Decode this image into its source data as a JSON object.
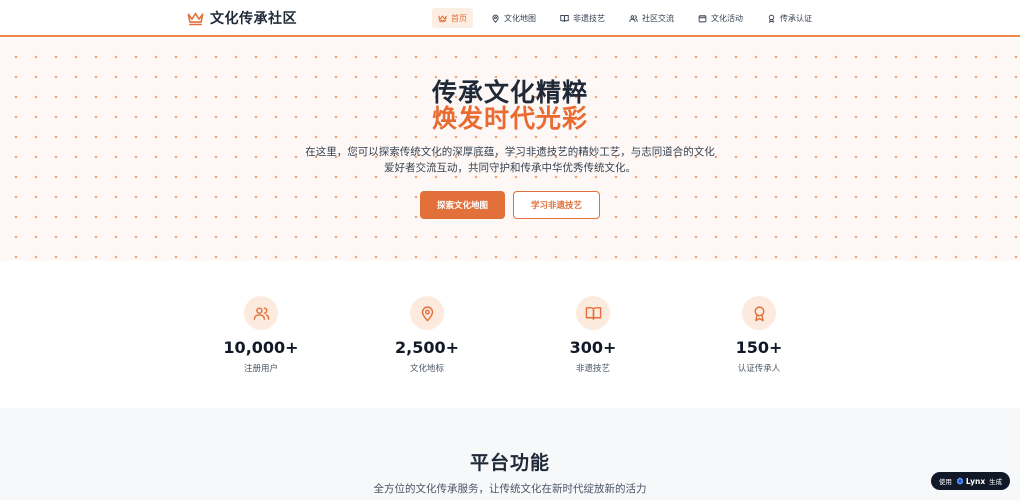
{
  "header": {
    "brand": "文化传承社区",
    "nav": [
      {
        "label": "首页",
        "icon": "crown-icon",
        "active": true
      },
      {
        "label": "文化地图",
        "icon": "map-pin-icon",
        "active": false
      },
      {
        "label": "非遗技艺",
        "icon": "book-icon",
        "active": false
      },
      {
        "label": "社区交流",
        "icon": "users-icon",
        "active": false
      },
      {
        "label": "文化活动",
        "icon": "calendar-icon",
        "active": false
      },
      {
        "label": "传承认证",
        "icon": "award-icon",
        "active": false
      }
    ]
  },
  "hero": {
    "title_line1": "传承文化精粹",
    "title_line2": "焕发时代光彩",
    "description": "在这里，您可以探索传统文化的深厚底蕴，学习非遗技艺的精妙工艺，与志同道合的文化爱好者交流互动，共同守护和传承中华优秀传统文化。",
    "primary_button": "探索文化地图",
    "secondary_button": "学习非遗技艺"
  },
  "stats": [
    {
      "value": "10,000+",
      "label": "注册用户",
      "icon": "users-icon"
    },
    {
      "value": "2,500+",
      "label": "文化地标",
      "icon": "map-pin-icon"
    },
    {
      "value": "300+",
      "label": "非遗技艺",
      "icon": "book-icon"
    },
    {
      "value": "150+",
      "label": "认证传承人",
      "icon": "award-icon"
    }
  ],
  "features": {
    "title": "平台功能",
    "subtitle": "全方位的文化传承服务，让传统文化在新时代绽放新的活力"
  },
  "badge": {
    "prefix": "使用",
    "name": "Lynx",
    "suffix": "生成"
  },
  "colors": {
    "accent": "#e2703a",
    "accent_light": "#fdeadf",
    "text_dark": "#1f2937"
  }
}
